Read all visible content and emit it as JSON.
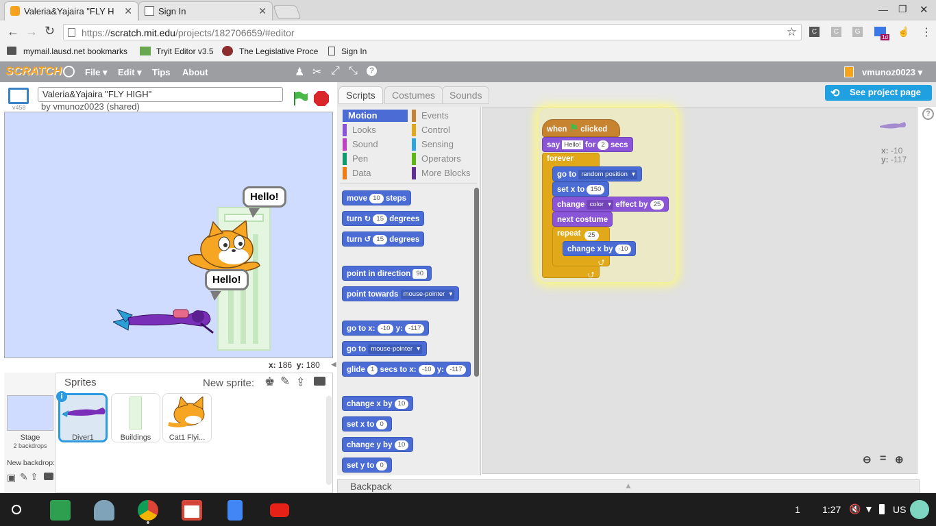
{
  "browser": {
    "tabs": [
      {
        "label": "Valeria&Yajaira \"FLY H",
        "active": true
      },
      {
        "label": "Sign In",
        "active": false
      }
    ],
    "address": {
      "secure_prefix": "https://",
      "host": "scratch.mit.edu",
      "path": "/projects/182706659/#editor"
    },
    "bookmarks": [
      "mymail.lausd.net bookmarks",
      "Tryit Editor v3.5",
      "The Legislative Proce",
      "Sign In"
    ],
    "extensions": [
      "C",
      "C",
      "G"
    ],
    "ext_badge": "1d"
  },
  "scratch": {
    "logo": "SCRATCH",
    "menu": [
      "File",
      "Edit",
      "Tips",
      "About"
    ],
    "user": "vmunoz0023",
    "version": "v458",
    "project_title": "Valeria&Yajaira \"FLY HIGH\"",
    "byline": "by vmunoz0023 (shared)",
    "speech_1": "Hello!",
    "speech_2": "Hello!",
    "mouse_x_label": "x:",
    "mouse_x": "186",
    "mouse_y_label": "y:",
    "mouse_y": "180",
    "sprites_title": "Sprites",
    "new_sprite": "New sprite:",
    "stage_label": "Stage",
    "stage_backdrops": "2 backdrops",
    "new_backdrop": "New backdrop:",
    "sprites": [
      "Diver1",
      "Buildings",
      "Cat1 Flyi..."
    ],
    "tabs": [
      "Scripts",
      "Costumes",
      "Sounds"
    ],
    "see_project": "See project page",
    "categories_left": [
      "Motion",
      "Looks",
      "Sound",
      "Pen",
      "Data"
    ],
    "categories_right": [
      "Events",
      "Control",
      "Sensing",
      "Operators",
      "More Blocks"
    ],
    "category_colors": {
      "Motion": "#4a6cd4",
      "Looks": "#8a55d7",
      "Sound": "#bb42c3",
      "Pen": "#0e9a6c",
      "Data": "#ee7d16",
      "Events": "#c88330",
      "Control": "#e1a91a",
      "Sensing": "#2ca5e2",
      "Operators": "#5cb712",
      "More Blocks": "#632d99"
    },
    "sprite_x_label": "x:",
    "sprite_x": "-10",
    "sprite_y_label": "y:",
    "sprite_y": "-117",
    "backpack": "Backpack",
    "palette": {
      "move": [
        "move",
        "10",
        "steps"
      ],
      "turn_right": [
        "turn",
        "15",
        "degrees"
      ],
      "turn_left": [
        "turn",
        "15",
        "degrees"
      ],
      "point_dir": [
        "point in direction",
        "90"
      ],
      "point_towards": [
        "point towards",
        "mouse-pointer"
      ],
      "goto_xy": [
        "go to x:",
        "-10",
        "y:",
        "-117"
      ],
      "goto": [
        "go to",
        "mouse-pointer"
      ],
      "glide": [
        "glide",
        "1",
        "secs to x:",
        "-10",
        "y:",
        "-117"
      ],
      "change_x": [
        "change x by",
        "10"
      ],
      "set_x": [
        "set x to",
        "0"
      ],
      "change_y": [
        "change y by",
        "10"
      ],
      "set_y": [
        "set y to",
        "0"
      ]
    },
    "script": {
      "hat": [
        "when",
        "clicked"
      ],
      "say": [
        "say",
        "Hello!",
        "for",
        "2",
        "secs"
      ],
      "forever": "forever",
      "goto": [
        "go to",
        "random position"
      ],
      "setx": [
        "set x to",
        "150"
      ],
      "change_effect": [
        "change",
        "color",
        "effect by",
        "25"
      ],
      "next_costume": "next costume",
      "repeat": [
        "repeat",
        "25"
      ],
      "changex": [
        "change x by",
        "-10"
      ]
    }
  },
  "taskbar": {
    "page": "1",
    "time": "1:27",
    "locale": "US"
  }
}
